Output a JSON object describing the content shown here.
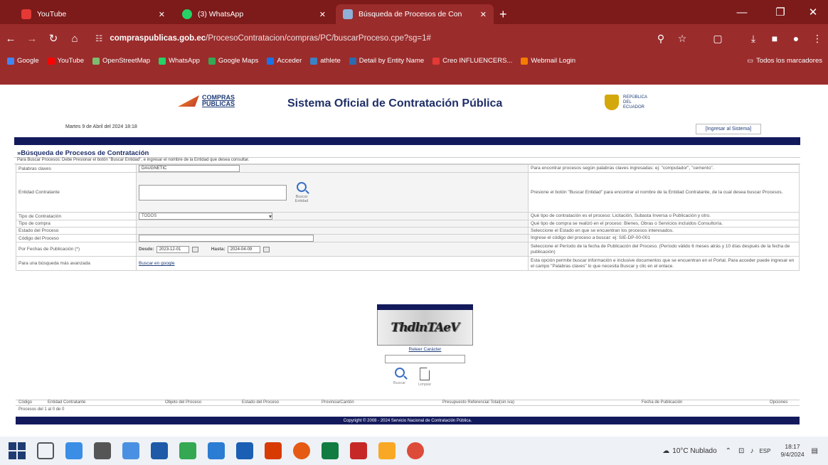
{
  "browser": {
    "tabs": [
      {
        "title": "YouTube",
        "color": "#e53935"
      },
      {
        "title": "(3) WhatsApp",
        "color": "#25d366"
      },
      {
        "title": "Búsqueda de Procesos de Con",
        "color": "#8fb0d8"
      }
    ],
    "url_domain": "compraspublicas.gob.ec",
    "url_path": "/ProcesoContratacion/compras/PC/buscarProceso.cpe?sg=1#",
    "bookmarks": [
      {
        "label": "Google",
        "color": "#4285f4"
      },
      {
        "label": "YouTube",
        "color": "#ff0000"
      },
      {
        "label": "OpenStreetMap",
        "color": "#7ebc6f"
      },
      {
        "label": "WhatsApp",
        "color": "#25d366"
      },
      {
        "label": "Google Maps",
        "color": "#34a853"
      },
      {
        "label": "Acceder",
        "color": "#1a73e8"
      },
      {
        "label": "athlete",
        "color": "#3b82c4"
      },
      {
        "label": "Detail by Entity Name",
        "color": "#2b6cb0"
      },
      {
        "label": "Creo INFLUENCERS...",
        "color": "#e53935"
      },
      {
        "label": "Webmail Login",
        "color": "#f57c00"
      }
    ],
    "all_bookmarks": "Todos los marcadores"
  },
  "page": {
    "logo_text_1": "COMPRAS",
    "logo_text_2": "PUBLICAS",
    "title": "Sistema Oficial de Contratación Pública",
    "ec_text": "REPÚBLICA DEL ECUADOR",
    "date": "Martes 9 de Abril del 2024 18:18",
    "enter": "[Ingresar al Sistema]",
    "section": "»Búsqueda de Procesos de Contratación",
    "note": "Para Buscar Procesos: Debe Presionar el botón \"Buscar Entidad\", e ingresar el nombre de la Entidad que desea consultar.",
    "rows": {
      "palabras": {
        "label": "Palabras claves",
        "value": "DAUGNETIC",
        "help": "Para encontrar procesos según palabras claves ingresadas: ej: \"computador\", \"cemento\"."
      },
      "entidad": {
        "label": "Entidad Contratante",
        "btn": "Buscar Entidad",
        "help": "Presione el botón \"Buscar Entidad\" para encontrar el nombre de la Entidad Contratante, de la cual desea buscar Procesos."
      },
      "tipo_contratacion": {
        "label": "Tipo de Contratación",
        "value": "TODOS",
        "help": "Qué tipo de contratación es el proceso: Licitación, Subasta Inversa o Publicación y otro."
      },
      "tipo_compra": {
        "label": "Tipo de compra",
        "help": "Qué tipo de compra se realizó en el proceso: Bienes, Obras o Servicios incluidos Consultoría."
      },
      "estado": {
        "label": "Estado del Proceso",
        "help": "Seleccione el Estado en que se encuentran los procesos interesados."
      },
      "codigo": {
        "label": "Código del Proceso",
        "help": "Ingrese el código del proceso a buscar: ej: SIE-DP-00-001"
      },
      "fechas": {
        "label": "Por Fechas de Publicación (*)",
        "desde_label": "Desde:",
        "desde": "2023-12-01",
        "hasta_label": "Hasta:",
        "hasta": "2024-04-09",
        "help": "Seleccione el Período de la fecha de Publicación del Proceso. (Período válido 6 meses atrás y 10 días después de la fecha de publicación)"
      },
      "avanzada": {
        "label": "Para una búsqueda más avanzada",
        "link": "Buscar en google",
        "help": "Esta opción permite buscar información e inclusive documentos que se encuentran en el Portal. Para acceder puede ingresar en el campo \"Palabras claves\" lo que necesita Buscar y clic en el enlace."
      }
    },
    "captcha": "ThdlnTAeV",
    "reload": "Releer Carácter",
    "search_btn": "Buscar",
    "clear_btn": "Limpiar",
    "columns": [
      "Código",
      "Entidad Contratante",
      "Objeto del Proceso",
      "Estado del Proceso",
      "Provincia/Cantón",
      "Presupuesto Referencial Total(sin iva)",
      "Fecha de Publicación",
      "Opciones"
    ],
    "count": "Procesos del 1 al 0 de 0",
    "footer": "Copyright © 2008 - 2024 Servicio Nacional de Contratación Pública."
  },
  "taskbar": {
    "weather": "10°C Nublado",
    "lang": "ESP",
    "time": "18:17",
    "date": "9/4/2024",
    "apps": [
      "#e8eaf0",
      "#3a8ee6",
      "#555",
      "#4a90e2",
      "#1e5aa8",
      "#34a853",
      "#2b7cd3",
      "#1a5fb4",
      "#d83b01",
      "#e55b13",
      "#107c41",
      "#c62828",
      "#f9a825",
      "#dd4b39"
    ]
  }
}
